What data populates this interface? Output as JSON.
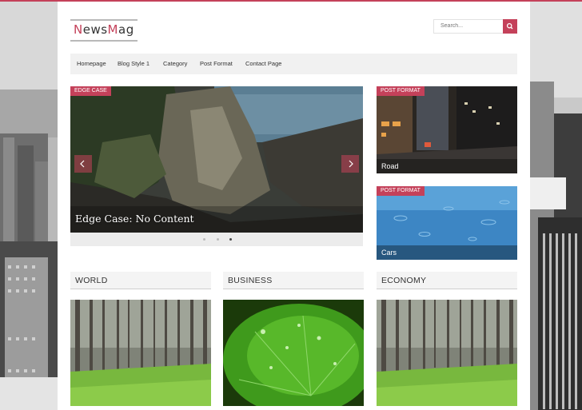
{
  "site": {
    "logo_first": "N",
    "logo_mid": "ews",
    "logo_m": "M",
    "logo_end": "ag"
  },
  "search": {
    "placeholder": "Search..."
  },
  "nav": {
    "items": [
      {
        "label": "Homepage"
      },
      {
        "label": "Blog Style 1"
      },
      {
        "label": "Category"
      },
      {
        "label": "Post Format"
      },
      {
        "label": "Contact Page"
      }
    ]
  },
  "slider": {
    "badge": "EDGE CASE",
    "title": "Edge Case: No Content",
    "slide_count": 3,
    "active_slide": 3
  },
  "side_cards": [
    {
      "badge": "POST FORMAT",
      "title": "Road"
    },
    {
      "badge": "POST FORMAT",
      "title": "Cars"
    }
  ],
  "sections": [
    {
      "title": "WORLD",
      "image": "forest"
    },
    {
      "title": "BUSINESS",
      "image": "leaf-with-droplets"
    },
    {
      "title": "ECONOMY",
      "image": "forest"
    }
  ],
  "colors": {
    "accent": "#c4415a"
  },
  "icons": {
    "search": "search-icon",
    "prev": "chevron-left-icon",
    "next": "chevron-right-icon"
  }
}
